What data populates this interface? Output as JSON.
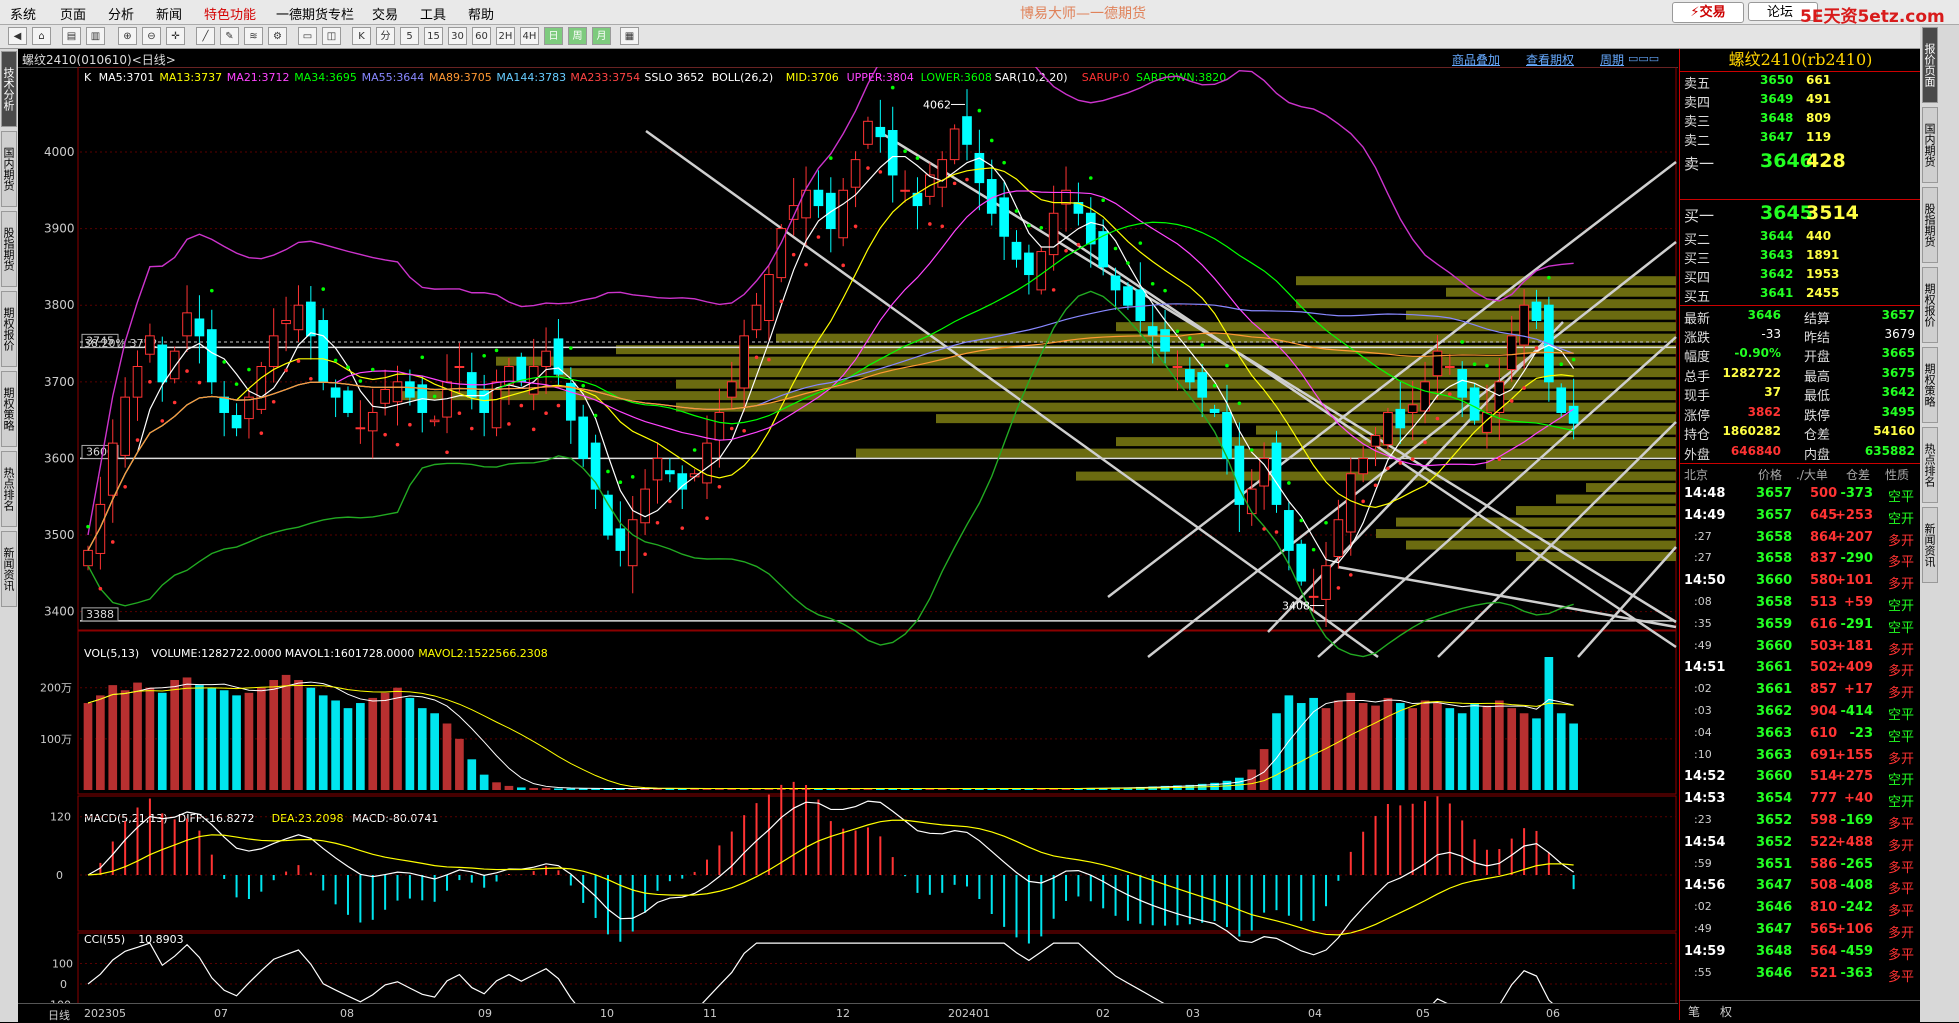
{
  "menu": [
    "系统",
    "页面",
    "分析",
    "新闻",
    "特色功能",
    "一德期货专栏",
    "交易",
    "工具",
    "帮助"
  ],
  "menu_highlight": "特色功能",
  "app_title": "博易大师—一德期货",
  "trade_button": "交易",
  "forum_button": "论坛",
  "watermark": "5E天资5etz.com",
  "toolbar_labels": [
    "K",
    "分",
    "5",
    "15",
    "30",
    "60",
    "2H",
    "4H",
    "日",
    "周",
    "月"
  ],
  "left_tabs": [
    "技术分析",
    "国内期货",
    "股指期货",
    "期权报价",
    "期权策略",
    "热点排名",
    "新闻资讯"
  ],
  "right_tabs": [
    "报价页面",
    "国内期货",
    "股指期货",
    "期权报价",
    "期权策略",
    "热点排名",
    "新闻资讯"
  ],
  "chart_header": {
    "title": "螺纹2410(010610)<日线>",
    "link1": "商品叠加",
    "link2": "查看期权",
    "link3": "周期"
  },
  "indicators": {
    "main": [
      {
        "text": "K",
        "color": "#ffffff"
      },
      {
        "text": "MA5:3701",
        "color": "#ffffff"
      },
      {
        "text": "MA13:3737",
        "color": "#ffff00"
      },
      {
        "text": "MA21:3712",
        "color": "#ff44ff"
      },
      {
        "text": "MA34:3695",
        "color": "#00ff00"
      },
      {
        "text": "MA55:3644",
        "color": "#8888ff"
      },
      {
        "text": "MA89:3705",
        "color": "#ff9933"
      },
      {
        "text": "MA144:3783",
        "color": "#66ccff"
      },
      {
        "text": "MA233:3754",
        "color": "#ff4444"
      },
      {
        "text": "SSLO 3652",
        "color": "#ffffff"
      },
      {
        "text": "BOLL(26,2)",
        "color": "#ffffff"
      },
      {
        "text": "MID:3706",
        "color": "#ffff00"
      },
      {
        "text": "UPPER:3804",
        "color": "#ff44ff"
      },
      {
        "text": "LOWER:3608",
        "color": "#00ff00"
      },
      {
        "text": "SAR(10,2,20)",
        "color": "#ffffff"
      },
      {
        "text": "SARUP:0",
        "color": "#ff3333"
      },
      {
        "text": "SARDOWN:3820",
        "color": "#00ff00"
      }
    ],
    "volume": [
      {
        "text": "VOL(5,13)",
        "color": "#ffffff"
      },
      {
        "text": "VOLUME:1282722.0000",
        "color": "#ffffff"
      },
      {
        "text": "MAVOL1:1601728.0000",
        "color": "#ffffff"
      },
      {
        "text": "MAVOL2:1522566.2308",
        "color": "#ffff00"
      }
    ],
    "macd": [
      {
        "text": "MACD(5,21,13)",
        "color": "#ffffff"
      },
      {
        "text": "DIFF:-16.8272",
        "color": "#ffffff"
      },
      {
        "text": "DEA:23.2098",
        "color": "#ffff00"
      },
      {
        "text": "MACD:-80.0741",
        "color": "#ffffff"
      }
    ],
    "cci": [
      {
        "text": "CCI(55)",
        "color": "#ffffff"
      },
      {
        "text": "10.8903",
        "color": "#ffffff"
      }
    ]
  },
  "price_axis": [
    "4000",
    "3900",
    "3800",
    "3700",
    "3600",
    "3500",
    "3400"
  ],
  "volume_axis": [
    "200万",
    "100万"
  ],
  "macd_axis": [
    "120",
    "0"
  ],
  "cci_axis": [
    "100",
    "0",
    "-100"
  ],
  "price_labels": {
    "hi": "4062",
    "lo": "3408",
    "box1": "3745",
    "box2": "3600",
    "box3": "3388",
    "fib": "38.20% 3752"
  },
  "x_axis": [
    "日线",
    "202305",
    "07",
    "08",
    "09",
    "10",
    "11",
    "12",
    "202401",
    "02",
    "03",
    "04",
    "05",
    "06"
  ],
  "quote": {
    "title": "螺纹2410(rb2410)",
    "asks": [
      {
        "label": "卖五",
        "price": "3650",
        "vol": "661"
      },
      {
        "label": "卖四",
        "price": "3649",
        "vol": "491"
      },
      {
        "label": "卖三",
        "price": "3648",
        "vol": "809"
      },
      {
        "label": "卖二",
        "price": "3647",
        "vol": "119"
      },
      {
        "label": "卖一",
        "price": "3646",
        "vol": "428"
      }
    ],
    "bids": [
      {
        "label": "买一",
        "price": "3645",
        "vol": "3514"
      },
      {
        "label": "买二",
        "price": "3644",
        "vol": "440"
      },
      {
        "label": "买三",
        "price": "3643",
        "vol": "1891"
      },
      {
        "label": "买四",
        "price": "3642",
        "vol": "1953"
      },
      {
        "label": "买五",
        "price": "3641",
        "vol": "2455"
      }
    ],
    "stats": [
      {
        "l1": "最新",
        "v1": "3646",
        "c1": "gr",
        "l2": "结算",
        "v2": "3657",
        "c2": "gr"
      },
      {
        "l1": "涨跌",
        "v1": "-33",
        "c1": "wh",
        "l2": "昨结",
        "v2": "3679",
        "c2": "wh"
      },
      {
        "l1": "幅度",
        "v1": "-0.90%",
        "c1": "gr",
        "l2": "开盘",
        "v2": "3665",
        "c2": "gr"
      },
      {
        "l1": "总手",
        "v1": "1282722",
        "c1": "yl",
        "l2": "最高",
        "v2": "3675",
        "c2": "gr"
      },
      {
        "l1": "现手",
        "v1": "37",
        "c1": "yl",
        "l2": "最低",
        "v2": "3642",
        "c2": "gr"
      },
      {
        "l1": "涨停",
        "v1": "3862",
        "c1": "rd",
        "l2": "跌停",
        "v2": "3495",
        "c2": "gr"
      },
      {
        "l1": "持仓",
        "v1": "1860282",
        "c1": "yl",
        "l2": "仓差",
        "v2": "54160",
        "c2": "yl"
      },
      {
        "l1": "外盘",
        "v1": "646840",
        "c1": "rd",
        "l2": "内盘",
        "v2": "635882",
        "c2": "gr"
      }
    ],
    "tick_header": [
      "北京",
      "价格",
      "./大单",
      "仓差",
      "性质"
    ],
    "ticks": [
      {
        "t": "14:48",
        "p": "3657",
        "v": "500",
        "d": "-373",
        "n": "空平",
        "nc": "gr"
      },
      {
        "t": "14:49",
        "p": "3657",
        "v": "645",
        "d": "+253",
        "n": "空开",
        "nc": "gr"
      },
      {
        "t": ":27",
        "p": "3658",
        "v": "864",
        "d": "+207",
        "n": "多开",
        "nc": "rd"
      },
      {
        "t": ":27",
        "p": "3658",
        "v": "837",
        "d": "-290",
        "n": "多平",
        "nc": "rd"
      },
      {
        "t": "14:50",
        "p": "3660",
        "v": "580",
        "d": "+101",
        "n": "多开",
        "nc": "rd"
      },
      {
        "t": ":08",
        "p": "3658",
        "v": "513",
        "d": "+59",
        "n": "空开",
        "nc": "gr"
      },
      {
        "t": ":35",
        "p": "3659",
        "v": "616",
        "d": "-291",
        "n": "空平",
        "nc": "gr"
      },
      {
        "t": ":49",
        "p": "3660",
        "v": "503",
        "d": "+181",
        "n": "多开",
        "nc": "rd"
      },
      {
        "t": "14:51",
        "p": "3661",
        "v": "502",
        "d": "+409",
        "n": "多开",
        "nc": "rd"
      },
      {
        "t": ":02",
        "p": "3661",
        "v": "857",
        "d": "+17",
        "n": "多开",
        "nc": "rd"
      },
      {
        "t": ":03",
        "p": "3662",
        "v": "904",
        "d": "-414",
        "n": "空平",
        "nc": "gr"
      },
      {
        "t": ":04",
        "p": "3663",
        "v": "610",
        "d": "-23",
        "n": "空平",
        "nc": "gr"
      },
      {
        "t": ":10",
        "p": "3663",
        "v": "691",
        "d": "+155",
        "n": "多开",
        "nc": "rd"
      },
      {
        "t": "14:52",
        "p": "3660",
        "v": "514",
        "d": "+275",
        "n": "空开",
        "nc": "gr"
      },
      {
        "t": "14:53",
        "p": "3654",
        "v": "777",
        "d": "+40",
        "n": "空开",
        "nc": "gr"
      },
      {
        "t": ":23",
        "p": "3652",
        "v": "598",
        "d": "-169",
        "n": "多平",
        "nc": "rd"
      },
      {
        "t": "14:54",
        "p": "3652",
        "v": "522",
        "d": "+488",
        "n": "多开",
        "nc": "rd"
      },
      {
        "t": ":59",
        "p": "3651",
        "v": "586",
        "d": "-265",
        "n": "多平",
        "nc": "rd"
      },
      {
        "t": "14:56",
        "p": "3647",
        "v": "508",
        "d": "-408",
        "n": "多平",
        "nc": "rd"
      },
      {
        "t": ":02",
        "p": "3646",
        "v": "810",
        "d": "-242",
        "n": "多平",
        "nc": "rd"
      },
      {
        "t": ":49",
        "p": "3647",
        "v": "565",
        "d": "+106",
        "n": "多开",
        "nc": "rd"
      },
      {
        "t": "14:59",
        "p": "3648",
        "v": "564",
        "d": "-459",
        "n": "多平",
        "nc": "rd"
      },
      {
        "t": ":55",
        "p": "3646",
        "v": "521",
        "d": "-363",
        "n": "多平",
        "nc": "rd"
      }
    ],
    "footer_tabs": [
      "笔",
      "权"
    ]
  },
  "chart_data": {
    "type": "candlestick",
    "title": "螺纹2410(010610)<日线>",
    "period_labels": [
      "202305",
      "07",
      "08",
      "09",
      "10",
      "11",
      "12",
      "202401",
      "02",
      "03",
      "04",
      "05",
      "06"
    ],
    "ylim": [
      3380,
      4090
    ],
    "marked_high": 4062,
    "marked_low": 3408,
    "horizontal_levels": [
      3745,
      3600,
      3388
    ],
    "fib_level": {
      "ratio": "38.20%",
      "value": 3752
    },
    "close_path": [
      3480,
      3540,
      3620,
      3680,
      3720,
      3760,
      3700,
      3740,
      3790,
      3760,
      3700,
      3660,
      3640,
      3680,
      3720,
      3760,
      3780,
      3800,
      3760,
      3700,
      3680,
      3660,
      3640,
      3660,
      3690,
      3700,
      3680,
      3660,
      3650,
      3700,
      3720,
      3680,
      3660,
      3700,
      3720,
      3700,
      3720,
      3740,
      3710,
      3650,
      3600,
      3560,
      3500,
      3480,
      3520,
      3560,
      3600,
      3580,
      3560,
      3580,
      3620,
      3660,
      3700,
      3760,
      3800,
      3840,
      3900,
      3930,
      3950,
      3930,
      3900,
      3950,
      3990,
      4040,
      4020,
      3970,
      3950,
      3930,
      3970,
      3990,
      4030,
      4010,
      3960,
      3920,
      3890,
      3860,
      3840,
      3870,
      3920,
      3950,
      3920,
      3880,
      3850,
      3820,
      3800,
      3780,
      3760,
      3740,
      3720,
      3700,
      3680,
      3660,
      3600,
      3540,
      3560,
      3600,
      3540,
      3480,
      3440,
      3420,
      3460,
      3520,
      3580,
      3600,
      3630,
      3660,
      3640,
      3670,
      3700,
      3740,
      3720,
      3680,
      3650,
      3660,
      3700,
      3760,
      3800,
      3780,
      3700,
      3660,
      3646
    ],
    "volume_wan": [
      170,
      185,
      205,
      195,
      210,
      200,
      190,
      215,
      220,
      205,
      200,
      195,
      185,
      190,
      200,
      215,
      225,
      215,
      200,
      185,
      175,
      160,
      170,
      180,
      190,
      200,
      180,
      160,
      150,
      130,
      100,
      60,
      30,
      15,
      8,
      5,
      4,
      4,
      3,
      3,
      3,
      3,
      3,
      3,
      3,
      3,
      3,
      3,
      3,
      3,
      3,
      3,
      3,
      3,
      3,
      3,
      3,
      3,
      3,
      3,
      3,
      3,
      3,
      3,
      3,
      3,
      3,
      3,
      3,
      3,
      3,
      3,
      3,
      3,
      3,
      3,
      3,
      3,
      3,
      3,
      3,
      4,
      4,
      5,
      5,
      6,
      7,
      8,
      9,
      10,
      12,
      14,
      18,
      24,
      40,
      80,
      150,
      185,
      170,
      180,
      160,
      175,
      190,
      170,
      165,
      180,
      170,
      160,
      175,
      170,
      160,
      150,
      170,
      165,
      175,
      160,
      150,
      140,
      260,
      150,
      130
    ]
  }
}
